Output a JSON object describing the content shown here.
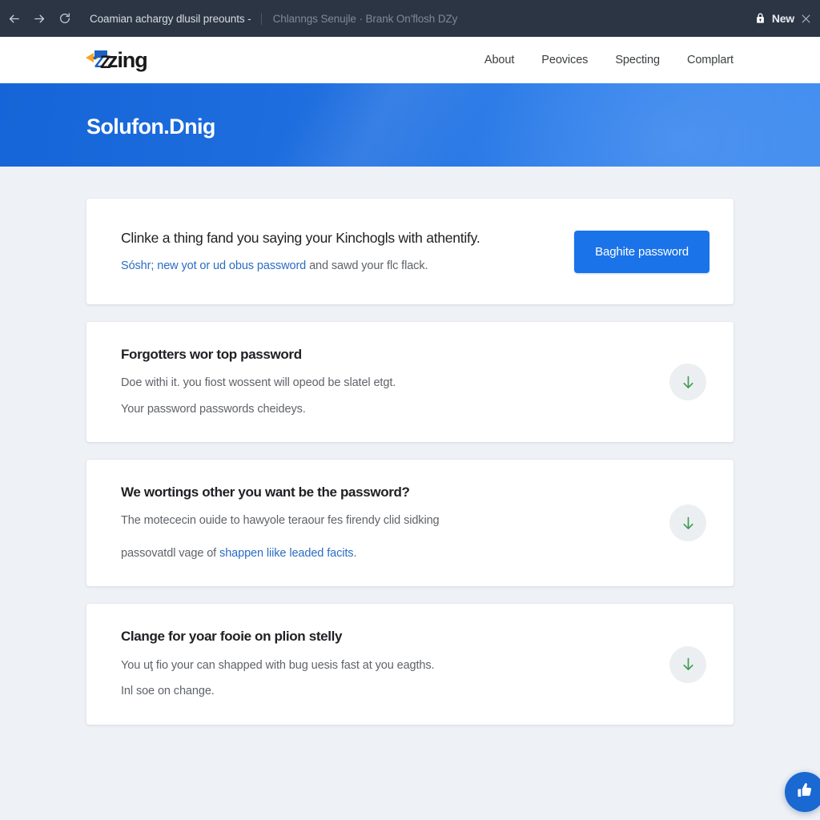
{
  "browser": {
    "back_icon": "back-arrow-icon",
    "forward_icon": "forward-arrow-icon",
    "reload_icon": "reload-icon",
    "tab_active_title": "Coamian achargy dlusil preounts -",
    "tab_inactive_title": "Chlanngs Senujle · Brank On'flosh DZy",
    "lock_icon": "lock-icon",
    "new_label": "New",
    "close_icon": "close-icon"
  },
  "header": {
    "logo_text": "zing",
    "logo_mark": "zz-logo-icon",
    "nav": [
      {
        "label": "About"
      },
      {
        "label": "Peovices"
      },
      {
        "label": "Specting"
      },
      {
        "label": "Complart"
      }
    ]
  },
  "hero": {
    "title": "Solufon.Dnig",
    "bg_start": "#1565d8",
    "bg_end": "#3d8bf0"
  },
  "prompt_card": {
    "headline": "Clinke a thing fand you saying your Kinchogls with athentify.",
    "sub_link": "Sóshr; new yot or ud obus password",
    "sub_rest": " and sawd your flc flack.",
    "button_label": "Baghite password",
    "button_color": "#1a73e8",
    "link_color": "#2b6cc4"
  },
  "help_cards": [
    {
      "title": "Forgotters wor top password",
      "lines": [
        "Doe withi it. you fiost wossent will opeod be slatel etgt.",
        "Your password passwords cheideys."
      ],
      "link_text": "",
      "link_tail": "",
      "action_icon": "download-arrow-icon"
    },
    {
      "title": "We wortings other you want be the password?",
      "lines": [
        "The motececin ouide to hawyole teraour fes firendy clid sidking"
      ],
      "link_prefix": "passovatdl vage of ",
      "link_text": "shappen liike leaded facits",
      "link_tail": ".",
      "action_icon": "download-arrow-icon"
    },
    {
      "title": "Clange for yoar fooiе on plion stelly",
      "lines": [
        "You uţ fio your can shapped with bug uesis fast at you eagths.",
        "Inl soe on change."
      ],
      "link_text": "",
      "link_tail": "",
      "action_icon": "download-arrow-icon"
    }
  ],
  "fab": {
    "icon": "thumbs-up-icon",
    "color": "#1a68d1"
  }
}
